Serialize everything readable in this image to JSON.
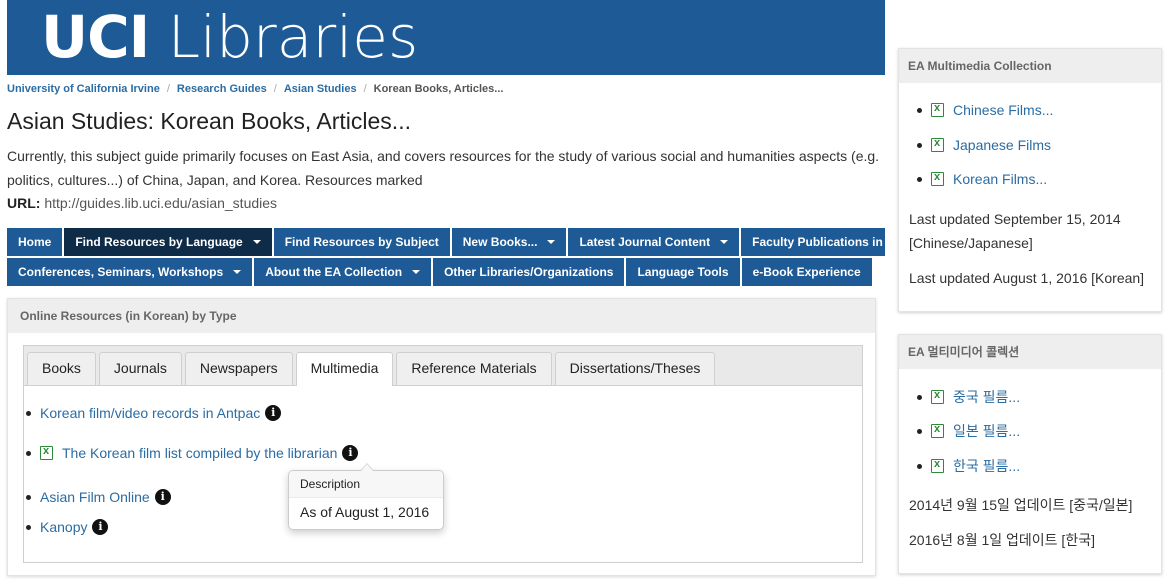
{
  "banner": {
    "logo_bold": "UCI",
    "logo_light": "Libraries"
  },
  "breadcrumb": {
    "items": [
      "University of California Irvine",
      "Research Guides",
      "Asian Studies"
    ],
    "current": "Korean Books, Articles...",
    "separator": "/"
  },
  "page": {
    "title": "Asian Studies: Korean Books, Articles...",
    "description_line1": "Currently, this subject guide primarily focuses on East Asia, and covers resources for the study of various social and humanities aspects (e.g.",
    "description_line2": "politics, cultures...) of China, Japan, and Korea. Resources marked",
    "url_label": "URL:",
    "url_value": "http://guides.lib.uci.edu/asian_studies"
  },
  "nav": {
    "row1": [
      "Home",
      "Find Resources by Language",
      "Find Resources by Subject",
      "New Books...",
      "Latest Journal Content",
      "Faculty Publications in the"
    ],
    "row2": [
      "Conferences, Seminars, Workshops",
      "About the EA Collection",
      "Other Libraries/Organizations",
      "Language Tools",
      "e-Book Experience"
    ]
  },
  "main_box": {
    "heading": "Online Resources (in Korean) by Type",
    "tabs": [
      "Books",
      "Journals",
      "Newspapers",
      "Multimedia",
      "Reference Materials",
      "Dissertations/Theses"
    ],
    "active_tab": "Multimedia",
    "items": [
      {
        "label": "Korean film/video records in Antpac",
        "icon": "bullet"
      },
      {
        "label": "The Korean film list compiled by the librarian",
        "icon": "spreadsheet-icon"
      },
      {
        "label": "Asian Film Online",
        "icon": "bullet"
      },
      {
        "label": "Kanopy",
        "icon": "bullet"
      }
    ]
  },
  "popover": {
    "title": "Description",
    "body": "As of August 1, 2016"
  },
  "sidebar_en": {
    "heading": "EA Multimedia Collection",
    "items": [
      "Chinese Films...",
      "Japanese Films",
      "Korean Films..."
    ],
    "note1_line1": "Last updated September 15, 2014",
    "note1_line2": "[Chinese/Japanese]",
    "note2": "Last updated August 1, 2016 [Korean]"
  },
  "sidebar_ko": {
    "heading": "EA 멀티미디어 콜렉션",
    "items": [
      "중국 필름...",
      "일본 필름...",
      "한국 필름..."
    ],
    "note1": "2014년 9월 15일 업데이트 [중국/일본]",
    "note2": "2016년 8월 1일 업데이트 [한국]"
  },
  "colors": {
    "brand_blue": "#1d5a96",
    "active_nav": "#0e2b48",
    "link": "#2b6ca3"
  }
}
